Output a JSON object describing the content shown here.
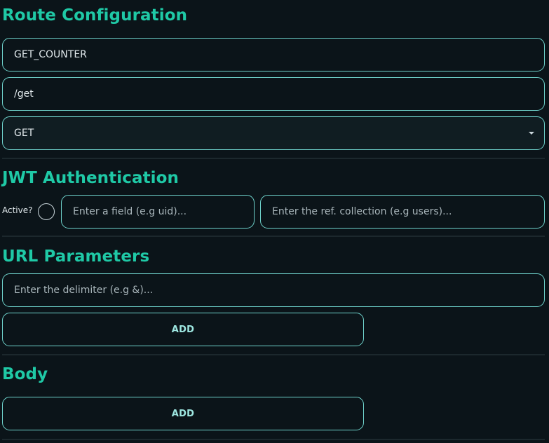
{
  "route_configuration": {
    "heading": "Route Configuration",
    "name_value": "GET_COUNTER",
    "path_value": "/get",
    "method_value": "GET"
  },
  "jwt_authentication": {
    "heading": "JWT Authentication",
    "active_label": "Active?",
    "active_checked": false,
    "field_placeholder": "Enter a field (e.g uid)...",
    "collection_placeholder": "Enter the ref. collection (e.g users)..."
  },
  "url_parameters": {
    "heading": "URL Parameters",
    "delimiter_placeholder": "Enter the delimiter (e.g &)...",
    "add_label": "ADD"
  },
  "body_section": {
    "heading": "Body",
    "add_label": "ADD"
  },
  "colors": {
    "background": "#0b1419",
    "accent": "#1fc9a6",
    "border": "#6fd3cc",
    "button_text": "#9ee7e1"
  },
  "icons": {
    "method_dropdown": "chevron-down-icon"
  }
}
